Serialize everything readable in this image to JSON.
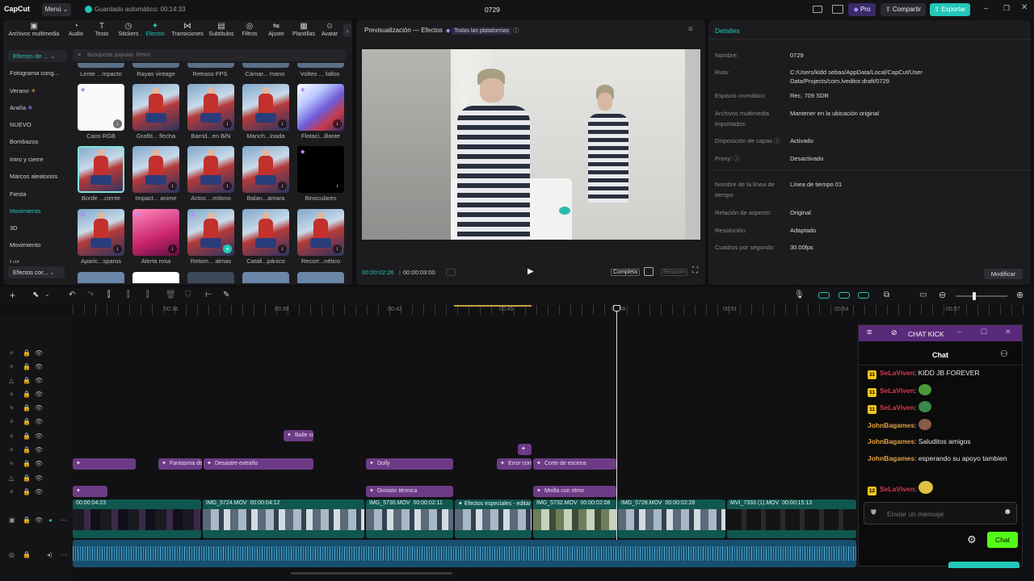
{
  "app": {
    "logo": "CapCut",
    "menu_label": "Menú",
    "autosave_text": "Guardado automático: 00:14:33",
    "project_title": "0729",
    "pro_label": "Pro",
    "share_label": "Compartir",
    "export_label": "Exportar",
    "accent_color": "#22c7b8"
  },
  "tabs": [
    {
      "label": "Archivos multimedia",
      "icon": "media-icon"
    },
    {
      "label": "Audio",
      "icon": "audio-icon"
    },
    {
      "label": "Texto",
      "icon": "text-icon"
    },
    {
      "label": "Stickers",
      "icon": "sticker-icon"
    },
    {
      "label": "Efectos",
      "icon": "effects-icon"
    },
    {
      "label": "Transiciones",
      "icon": "transitions-icon"
    },
    {
      "label": "Subtítulos",
      "icon": "subtitles-icon"
    },
    {
      "label": "Filtros",
      "icon": "filters-icon"
    },
    {
      "label": "Ajuste",
      "icon": "adjust-icon"
    },
    {
      "label": "Plantillas",
      "icon": "templates-icon"
    },
    {
      "label": "Avatar",
      "icon": "avatar-icon"
    }
  ],
  "effects": {
    "dropdown_label": "Efectos de ...",
    "search_placeholder": "Búsqueda popular: Retro",
    "categories": [
      "Fotograma cong...",
      "Verano",
      "Araña",
      "NUEVO",
      "Bombazos",
      "Intro y cierre",
      "Marcos aleatorios",
      "Fiesta",
      "Movimiento",
      "3D",
      "Movimiento",
      "Luz"
    ],
    "bottom_dropdown": "Efectos cor...",
    "top_row_labels": [
      "Lente ...mpacto",
      "Rayas vintage",
      "Retraso FPS",
      "Cámar... mano",
      "Volteo ... fallos"
    ],
    "grid_labels": [
      [
        "Caos RGB",
        "Grafiti... flecha",
        "Barrid...en B/N",
        "Manch...inada",
        "Flotaci...illante"
      ],
      [
        "Borde ...ciente",
        "Impact... anime",
        "Actos ...mitono",
        "Balan...ámara",
        "Binoculares"
      ],
      [
        "Aparic...sparos",
        "Alerta rosa",
        "Retom... almas",
        "Catali...pánico",
        "Recorr...nético"
      ]
    ]
  },
  "preview": {
    "title": "Previsualización — Efectos",
    "platform_label": "Todas las plataformas",
    "current_time": "00:00:02:26",
    "total_time": "00:00:03:00",
    "complete_label": "Completa",
    "ratio_label": "Relación"
  },
  "details": {
    "header": "Detalles",
    "fields": [
      {
        "label": "Nombre:",
        "value": "0729"
      },
      {
        "label": "Ruta:",
        "value": "C:/Users/kidd sebas/AppData/Local/CapCut/User Data/Projects/com.lveditor.draft/0729"
      },
      {
        "label": "Espacio cromático:",
        "value": "Rec. 709 SDR"
      },
      {
        "label": "Archivos multimedia importados:",
        "value": "Mantener en la ubicación original"
      },
      {
        "label": "Disposición de capas",
        "value": "Activado"
      },
      {
        "label": "Proxy:",
        "value": "Desactivado"
      },
      {
        "label": "Nombre de la línea de tiempo",
        "value": "Línea de tiempo 01"
      },
      {
        "label": "Relación de aspecto:",
        "value": "Original"
      },
      {
        "label": "Resolución:",
        "value": "Adaptado"
      },
      {
        "label": "Cuadros por segundo:",
        "value": "30.00fps"
      }
    ],
    "modify_label": "Modificar"
  },
  "timeline": {
    "ruler": [
      "00:36",
      "00:39",
      "00:42",
      "00:45",
      "00:48",
      "00:51",
      "00:54",
      "00:57"
    ],
    "effect_clips": [
      {
        "label": "Baile co"
      },
      {
        "label": ""
      },
      {
        "label": ""
      },
      {
        "label": "Fantasma de"
      },
      {
        "label": "Desastre extraño"
      },
      {
        "label": "Dolly"
      },
      {
        "label": "Error con"
      },
      {
        "label": "Corte de escena"
      },
      {
        "label": ""
      },
      {
        "label": "División térmica"
      },
      {
        "label": "Mirilla con ritmo"
      }
    ],
    "video_clips": [
      {
        "name": "",
        "duration": "00:00:04:23"
      },
      {
        "name": "IMG_5724.MOV",
        "duration": "00:00:04:12"
      },
      {
        "name": "IMG_5730.MOV",
        "duration": "00:00:02:11"
      },
      {
        "name": "Efectos especiales - editar",
        "duration": ""
      },
      {
        "name": "IMG_5732.MOV",
        "duration": "00:00:02:08"
      },
      {
        "name": "IMG_5728.MOV",
        "duration": "00:00:02:28"
      },
      {
        "name": "MVI_7333 (1).MOV",
        "duration": "00:00:15:13"
      }
    ]
  },
  "chat": {
    "window_title": "CHAT KICK",
    "header": "Chat",
    "messages": [
      {
        "badge": "11",
        "user": "SeLaViven",
        "text": ": KIDD JB FOREVER"
      },
      {
        "badge": "11",
        "user": "SeLaViven",
        "text": ":"
      },
      {
        "badge": "11",
        "user": "SeLaViven",
        "text": ":"
      },
      {
        "badge": "",
        "user": "JohnBagames",
        "text": ":"
      },
      {
        "badge": "",
        "user": "JohnBagames",
        "text": ": Saluditos amigos"
      },
      {
        "badge": "",
        "user": "JohnBagames",
        "text": ": esperando su apoyo tambien"
      },
      {
        "badge": "12",
        "user": "SeLaViven",
        "text": ":"
      }
    ],
    "input_placeholder": "Enviar un mensaje",
    "send_label": "Chat"
  }
}
